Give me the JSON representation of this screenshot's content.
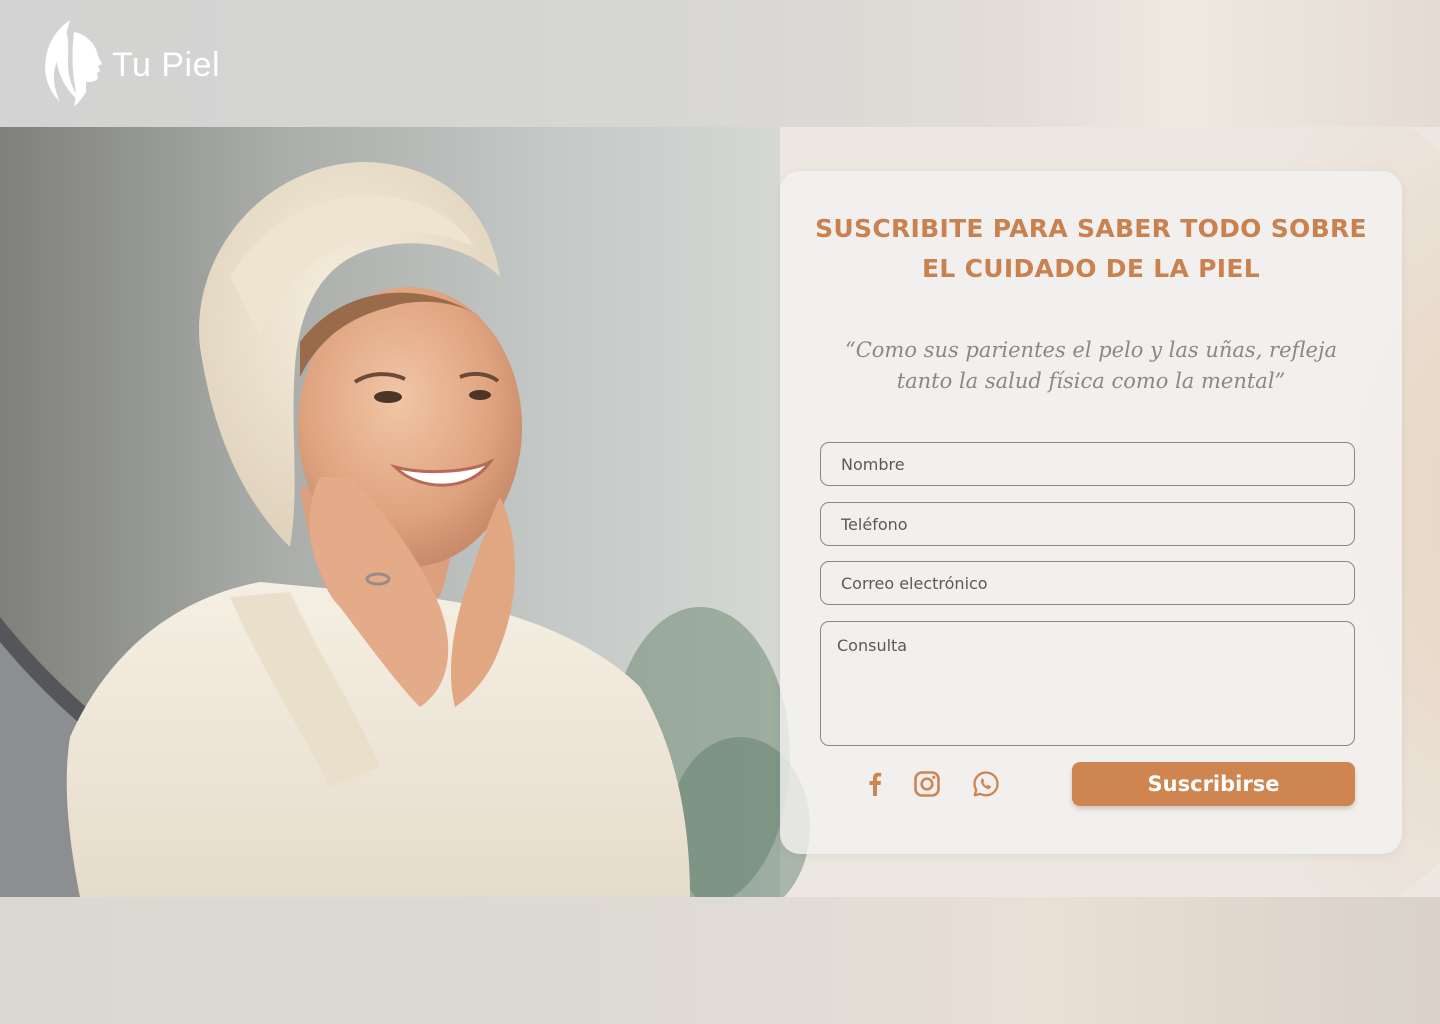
{
  "brand": {
    "name": "Tu Piel",
    "logo_icon": "woman-profile-icon"
  },
  "hero": {
    "image": "woman-in-towel-touching-face-in-mirror"
  },
  "subscribe": {
    "title_line1": "SUSCRIBITE PARA SABER TODO SOBRE",
    "title_line2": "EL CUIDADO DE LA PIEL",
    "quote_line1": "“Como sus parientes el pelo y las uñas, refleja",
    "quote_line2": "tanto la salud física como la mental”",
    "fields": {
      "name_placeholder": "Nombre",
      "phone_placeholder": "Teléfono",
      "email_placeholder": "Correo electrónico",
      "message_placeholder": "Consulta"
    },
    "socials": [
      "facebook-icon",
      "instagram-icon",
      "whatsapp-icon"
    ],
    "submit_label": "Suscribirse"
  },
  "colors": {
    "accent": "#cf8550",
    "title": "#c9824f",
    "quote": "#8c8784",
    "field_border": "#8a8683"
  }
}
